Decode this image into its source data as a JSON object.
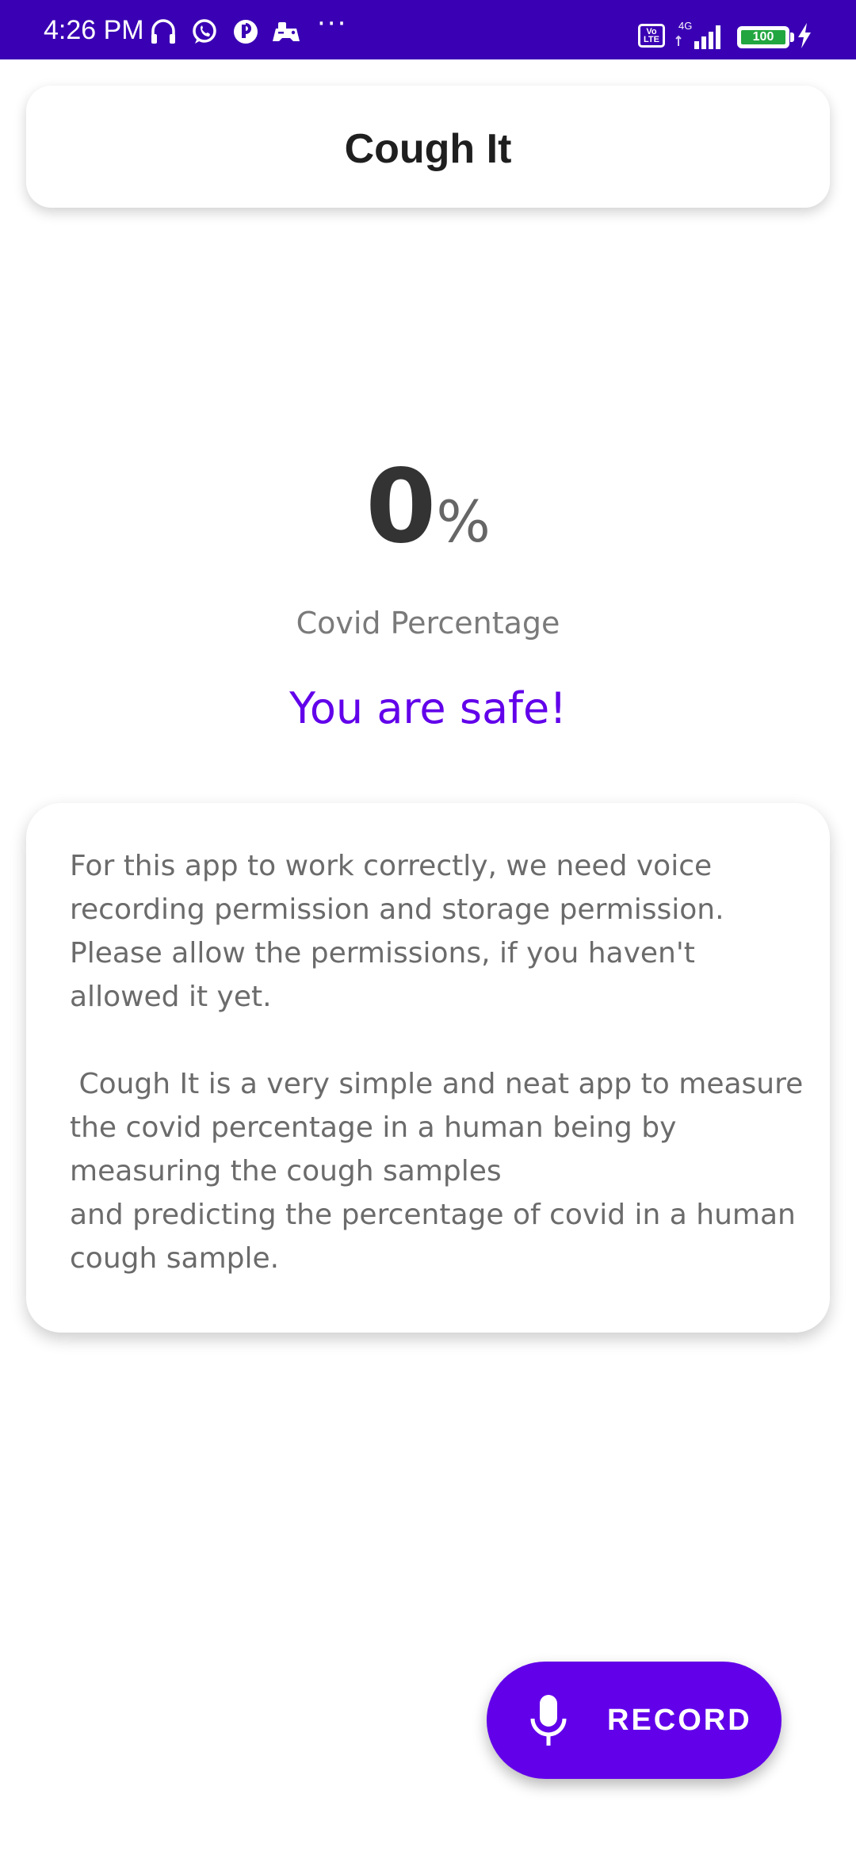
{
  "status_bar": {
    "time": "4:26 PM",
    "more": "···",
    "volte": "Vo LTE",
    "network": "4G",
    "battery": "100",
    "icons": [
      "headphones-icon",
      "whatsapp-icon",
      "app-notification-icon",
      "game-controller-icon",
      "signal-icon",
      "battery-icon",
      "charging-icon"
    ]
  },
  "header": {
    "title": "Cough It"
  },
  "result": {
    "percent_value": "0",
    "percent_sign": "%",
    "label": "Covid Percentage",
    "status": "You are safe!"
  },
  "info": {
    "text": "For this app to work correctly, we need voice recording permission and storage permission. Please allow the permissions, if you haven't allowed it yet.\n\n Cough It is a very simple and neat app to measure the covid percentage in a human being by measuring the cough samples\nand predicting the percentage of covid in a human cough sample."
  },
  "fab": {
    "label": "RECORD",
    "icon": "microphone-icon"
  },
  "colors": {
    "status_bar": "#3a00b4",
    "accent": "#6200ea",
    "text_dark": "#1f1f1f",
    "text_muted": "#6b6b6b",
    "battery_green": "#22a640"
  }
}
